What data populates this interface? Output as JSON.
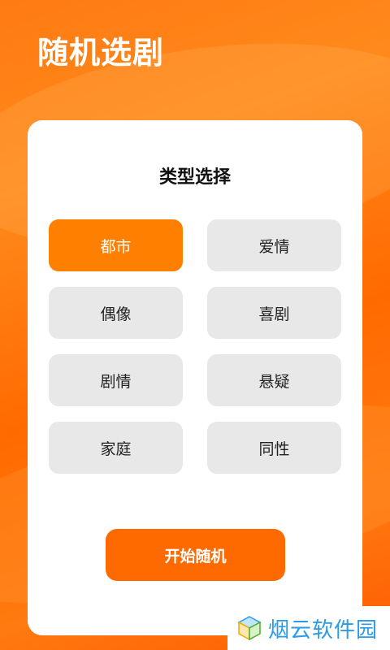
{
  "app": {
    "title": "随机选剧"
  },
  "card": {
    "title": "类型选择",
    "types": [
      {
        "label": "都市",
        "selected": true
      },
      {
        "label": "爱情",
        "selected": false
      },
      {
        "label": "偶像",
        "selected": false
      },
      {
        "label": "喜剧",
        "selected": false
      },
      {
        "label": "剧情",
        "selected": false
      },
      {
        "label": "悬疑",
        "selected": false
      },
      {
        "label": "家庭",
        "selected": false
      },
      {
        "label": "同性",
        "selected": false
      }
    ],
    "start_label": "开始随机"
  },
  "watermark": {
    "text": "烟云软件园",
    "icon": "cube-logo-icon"
  },
  "colors": {
    "accent": "#ff8000",
    "button": "#ff6a00",
    "chip": "#e8e8e8",
    "watermark": "#2a9be8"
  }
}
